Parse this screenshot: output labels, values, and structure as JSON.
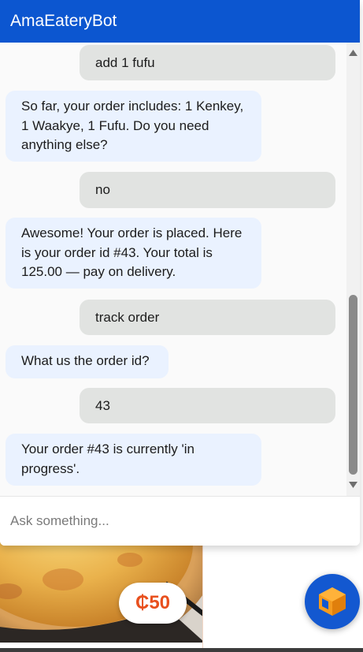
{
  "chat": {
    "title": "AmaEateryBot",
    "input_placeholder": "Ask something...",
    "messages": [
      {
        "from": "user",
        "text": "add 1 fufu"
      },
      {
        "from": "bot",
        "text": "So far, your order includes: 1 Kenkey, 1 Waakye, 1 Fufu. Do you need anything else?"
      },
      {
        "from": "user",
        "text": "no"
      },
      {
        "from": "bot",
        "text": "Awesome! Your order is placed. Here is your order id #43. Your total is 125.00 — pay on delivery."
      },
      {
        "from": "user",
        "text": "track order"
      },
      {
        "from": "bot",
        "text": "What us the order id?"
      },
      {
        "from": "user",
        "text": "43"
      },
      {
        "from": "bot",
        "text": "Your order #43 is currently 'in progress'."
      }
    ]
  },
  "product": {
    "price": "₵50"
  },
  "colors": {
    "header": "#0c56d0",
    "user_bubble": "#e1e3e1",
    "bot_bubble": "#eaf2ff",
    "price": "#e8501e",
    "launcher": "#1358d0"
  },
  "icons": {
    "launcher": "cube-icon",
    "scroll_up": "triangle-up-icon",
    "scroll_down": "triangle-down-icon"
  }
}
